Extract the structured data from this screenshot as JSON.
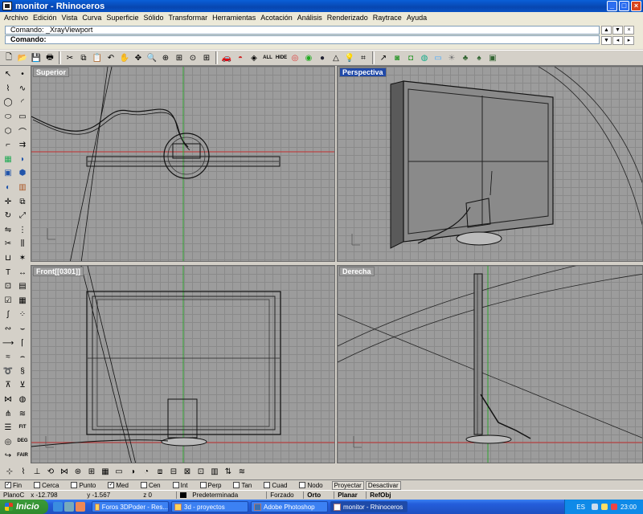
{
  "window": {
    "title": "monitor - Rhinoceros"
  },
  "menu": [
    "Archivo",
    "Edición",
    "Vista",
    "Curva",
    "Superficie",
    "Sólido",
    "Transformar",
    "Herramientas",
    "Acotación",
    "Análisis",
    "Renderizado",
    "Raytrace",
    "Ayuda"
  ],
  "command": {
    "history": "Comando: _XrayViewport",
    "prompt": "Comando:"
  },
  "toolbar": {
    "text_all": "ALL",
    "text_hide": "HIDE"
  },
  "left_toolbar": {
    "text_fit": "FIT",
    "text_deg": "DEG",
    "text_fair": "FAIR"
  },
  "viewports": {
    "top": {
      "label": "Superior"
    },
    "perspective": {
      "label": "Perspectiva"
    },
    "front": {
      "label": "Front[[0301]]"
    },
    "right": {
      "label": "Derecha"
    }
  },
  "osnap": {
    "items": [
      {
        "label": "Fin",
        "checked": true
      },
      {
        "label": "Cerca",
        "checked": false
      },
      {
        "label": "Punto",
        "checked": false
      },
      {
        "label": "Med",
        "checked": true
      },
      {
        "label": "Cen",
        "checked": false
      },
      {
        "label": "Int",
        "checked": false
      },
      {
        "label": "Perp",
        "checked": false
      },
      {
        "label": "Tan",
        "checked": false
      },
      {
        "label": "Cuad",
        "checked": false
      },
      {
        "label": "Nodo",
        "checked": false
      }
    ],
    "project": "Proyectar",
    "disable": "Desactivar"
  },
  "status": {
    "plane": "PlanoC",
    "x": "x -12.798",
    "y": "y -1.567",
    "z": "z 0",
    "layer": "Predeterminada",
    "forced": "Forzado",
    "ortho": "Orto",
    "planar": "Planar",
    "refobj": "RefObj"
  },
  "taskbar": {
    "start": "Inicio",
    "tasks": [
      "Foros 3DPoder - Res...",
      "3d - proyectos",
      "Adobe Photoshop",
      "monitor - Rhinoceros"
    ],
    "lang": "ES",
    "clock": "23:00"
  },
  "colors": {
    "titlebar": "#0a54c6",
    "viewport_bg": "#9c9c9c",
    "active_label": "#2049a8",
    "x_axis": "#c23030",
    "y_axis": "#2fa32f"
  }
}
